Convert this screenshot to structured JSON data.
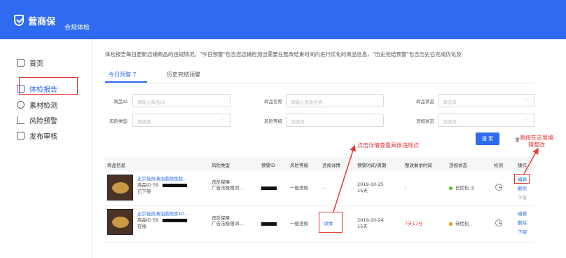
{
  "header": {
    "brand": "营商保",
    "subtitle": "合规体检"
  },
  "sidebar": {
    "items": [
      {
        "label": "首页",
        "icon": "home-icon"
      },
      {
        "label": "体检报告",
        "icon": "report-icon",
        "active": true
      },
      {
        "label": "素材检测",
        "icon": "material-scan-icon"
      },
      {
        "label": "风险预警",
        "icon": "risk-trend-icon"
      },
      {
        "label": "发布审核",
        "icon": "publish-review-icon"
      }
    ]
  },
  "notice": "体检报告每日更新店铺商品的违规情况。\"今日预警\"包含您店铺检测出需要在整改结束时间内进行优化的商品信息，\"历史完结预警\"包含历史已完成优化及",
  "tabs": [
    "今日预警 7",
    "历史完结预警"
  ],
  "filters": {
    "product_id": {
      "label": "商品ID",
      "placeholder": "请输入商品ID"
    },
    "product_name": {
      "label": "商品名称",
      "placeholder": "请输入商品名称"
    },
    "product_status": {
      "label": "商品状态",
      "placeholder": "请选择"
    },
    "risk_type": {
      "label": "风险类型",
      "placeholder": "请选择"
    },
    "risk_level": {
      "label": "风险等级",
      "placeholder": "请选择"
    },
    "violation_status": {
      "label": "违规状态",
      "placeholder": "请选择"
    }
  },
  "search_label": "搜 索",
  "reset_label": "重",
  "annotations": {
    "detail_note": "点击详情查看具体违规点",
    "edit_note": "直接在这里编辑整改"
  },
  "table": {
    "columns": [
      "商品信息",
      "风险类型",
      "预警ID",
      "风险等级",
      "违规详情",
      "预警时间/周期",
      "整改剩余时间",
      "违规状态",
      "检测",
      "操作"
    ],
    "rows": [
      {
        "title": "正宗佳凯满油荔荫食超...",
        "pid": "商品ID 59",
        "status": "已下架",
        "risk_type_1": "违反保障",
        "risk_type_2": "广告法极限词...",
        "level": "一般违规",
        "detail": "-",
        "date": "2019-10-25",
        "period": "15天",
        "remaining": "-",
        "vstatus": "已优化",
        "vstatus_color": "#52c41a",
        "actions": [
          "编辑",
          "删除",
          "下架"
        ]
      },
      {
        "title": "正宗佳凯满油荔荫食10...",
        "pid": "商品ID 59",
        "status": "在线",
        "risk_type_1": "违反保障",
        "risk_type_2": "广告法极限词...",
        "level": "一般违规",
        "detail": "详情",
        "date": "2019-10-24",
        "period": "15天",
        "remaining": "7天17分",
        "vstatus": "待优化",
        "vstatus_color": "#fa8c16",
        "actions": [
          "编辑",
          "删除",
          "下架"
        ]
      }
    ]
  }
}
